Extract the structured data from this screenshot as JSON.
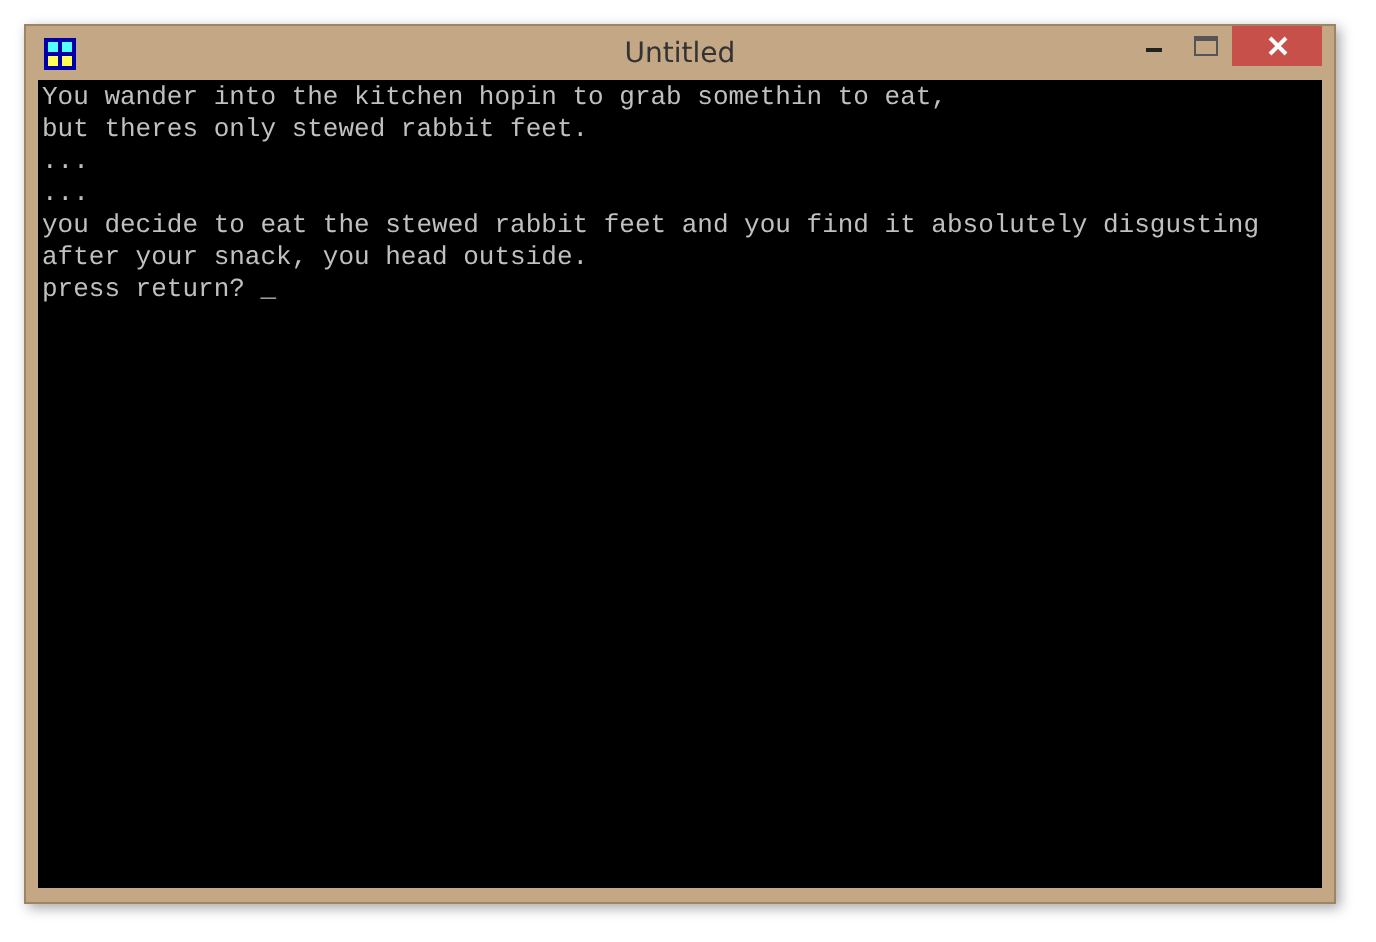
{
  "window": {
    "title": "Untitled"
  },
  "console": {
    "lines": [
      "You wander into the kitchen hopin to grab somethin to eat,",
      "but theres only stewed rabbit feet.",
      "...",
      "...",
      "you decide to eat the stewed rabbit feet and you find it absolutely disgusting",
      "after your snack, you head outside.",
      "press return? _"
    ]
  }
}
